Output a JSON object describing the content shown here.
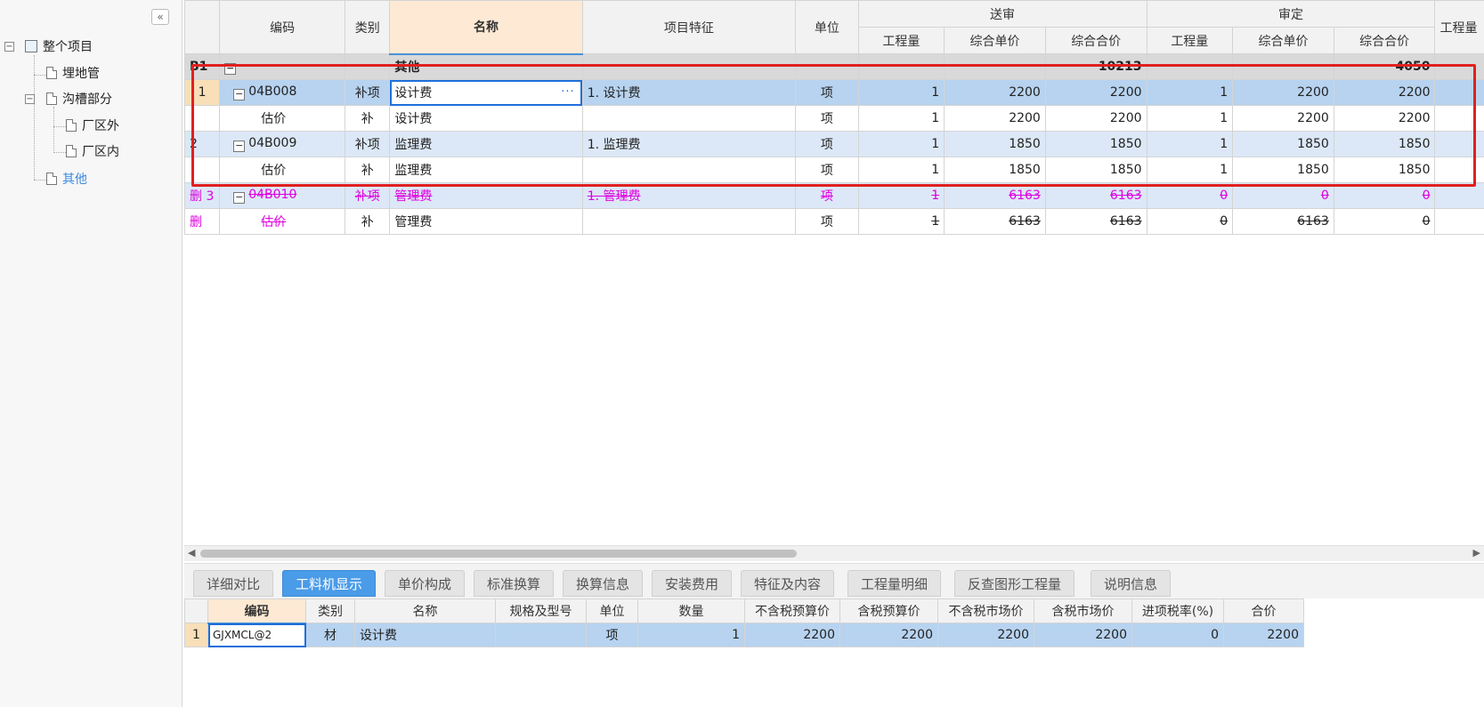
{
  "tree": {
    "collapse_icon": "«",
    "items": [
      {
        "label": "整个项目"
      },
      {
        "label": "埋地管"
      },
      {
        "label": "沟槽部分"
      },
      {
        "label": "厂区外"
      },
      {
        "label": "厂区内"
      },
      {
        "label": "其他"
      }
    ]
  },
  "grid": {
    "headers": {
      "code": "编码",
      "category": "类别",
      "name": "名称",
      "feature": "项目特征",
      "unit": "单位",
      "submit_group": "送审",
      "approve_group": "审定",
      "qty": "工程量",
      "unit_price": "综合单价",
      "total": "综合合价",
      "qty2": "工程量",
      "unit_price2": "综合单价",
      "total2": "综合合价",
      "extra": "工程量"
    },
    "rows": [
      {
        "idx": "B1",
        "code": "",
        "cat": "",
        "name": "其他",
        "feat": "",
        "unit": "",
        "q1": "",
        "p1": "",
        "t1": "10213",
        "q2": "",
        "p2": "",
        "t2": "4050"
      },
      {
        "idx": "1",
        "code": "04B008",
        "cat": "补项",
        "name": "设计费",
        "feat": "1. 设计费",
        "unit": "项",
        "q1": "1",
        "p1": "2200",
        "t1": "2200",
        "q2": "1",
        "p2": "2200",
        "t2": "2200"
      },
      {
        "idx": "",
        "code": "估价",
        "cat": "补",
        "name": "设计费",
        "feat": "",
        "unit": "项",
        "q1": "1",
        "p1": "2200",
        "t1": "2200",
        "q2": "1",
        "p2": "2200",
        "t2": "2200"
      },
      {
        "idx": "2",
        "code": "04B009",
        "cat": "补项",
        "name": "监理费",
        "feat": "1. 监理费",
        "unit": "项",
        "q1": "1",
        "p1": "1850",
        "t1": "1850",
        "q2": "1",
        "p2": "1850",
        "t2": "1850"
      },
      {
        "idx": "",
        "code": "估价",
        "cat": "补",
        "name": "监理费",
        "feat": "",
        "unit": "项",
        "q1": "1",
        "p1": "1850",
        "t1": "1850",
        "q2": "1",
        "p2": "1850",
        "t2": "1850"
      },
      {
        "idx": "删 3",
        "code": "04B010",
        "cat": "补项",
        "name": "管理费",
        "feat": "1. 管理费",
        "unit": "项",
        "q1": "1",
        "p1": "6163",
        "t1": "6163",
        "q2": "0",
        "p2": "0",
        "t2": "0"
      },
      {
        "idx": "删",
        "code": "估价",
        "cat": "补",
        "name": "管理费",
        "feat": "",
        "unit": "项",
        "q1": "1",
        "p1": "6163",
        "t1": "6163",
        "q2": "0",
        "p2": "6163",
        "t2": "0"
      }
    ],
    "edit_ellipsis": "···",
    "collapse_glyph": "−",
    "colors": {
      "selected_row": "#b7d3f0",
      "deleted_text": "#e000e0",
      "highlight_box": "#e02020",
      "active_tab": "#4a9be8"
    }
  },
  "tabs": [
    {
      "label": "详细对比"
    },
    {
      "label": "工料机显示"
    },
    {
      "label": "单价构成"
    },
    {
      "label": "标准换算"
    },
    {
      "label": "换算信息"
    },
    {
      "label": "安装费用"
    },
    {
      "label": "特征及内容"
    },
    {
      "label": "工程量明细"
    },
    {
      "label": "反查图形工程量"
    },
    {
      "label": "说明信息"
    }
  ],
  "detail": {
    "headers": [
      "编码",
      "类别",
      "名称",
      "规格及型号",
      "单位",
      "数量",
      "不含税预算价",
      "含税预算价",
      "不含税市场价",
      "含税市场价",
      "进项税率(%)",
      "合价"
    ],
    "row": {
      "idx": "1",
      "code": "GJXMCL@2",
      "cat": "材",
      "name": "设计费",
      "spec": "",
      "unit": "项",
      "qty": "1",
      "p1": "2200",
      "p2": "2200",
      "p3": "2200",
      "p4": "2200",
      "rate": "0",
      "total": "2200"
    }
  }
}
